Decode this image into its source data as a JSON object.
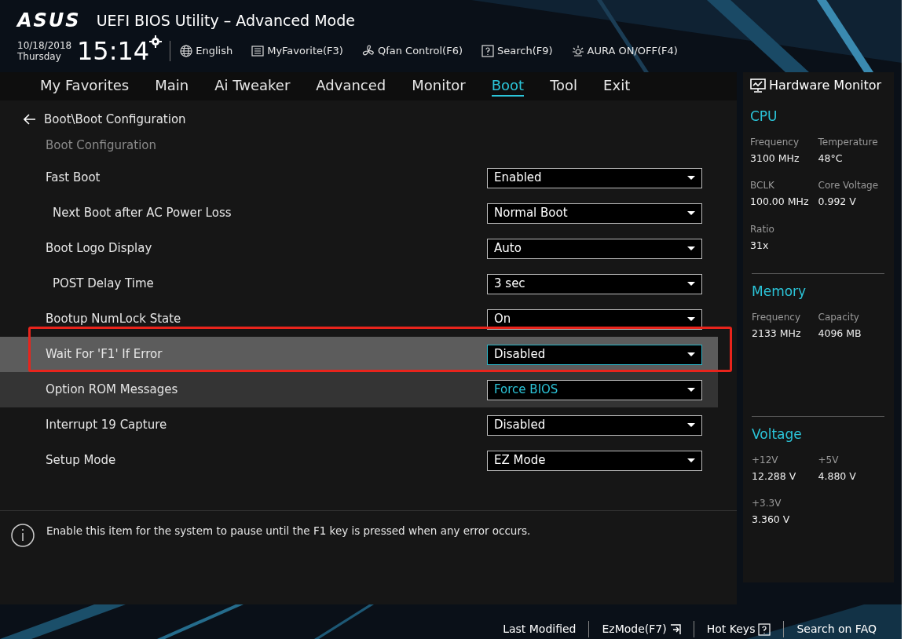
{
  "header": {
    "brand": "ASUS",
    "title": "UEFI BIOS Utility – Advanced Mode",
    "date": "10/18/2018",
    "day": "Thursday",
    "time": "15:14",
    "tools": [
      {
        "label": "English",
        "kind": "globe"
      },
      {
        "label": "MyFavorite(F3)",
        "kind": "favorite"
      },
      {
        "label": "Qfan Control(F6)",
        "kind": "fan"
      },
      {
        "label": "Search(F9)",
        "kind": "search"
      },
      {
        "label": "AURA ON/OFF(F4)",
        "kind": "aura"
      }
    ]
  },
  "tabs": [
    {
      "label": "My Favorites",
      "selected": false
    },
    {
      "label": "Main",
      "selected": false
    },
    {
      "label": "Ai Tweaker",
      "selected": false
    },
    {
      "label": "Advanced",
      "selected": false
    },
    {
      "label": "Monitor",
      "selected": false
    },
    {
      "label": "Boot",
      "selected": true
    },
    {
      "label": "Tool",
      "selected": false
    },
    {
      "label": "Exit",
      "selected": false
    }
  ],
  "breadcrumb": "Boot\\Boot Configuration",
  "section_title": "Boot Configuration",
  "settings": [
    {
      "label": "Fast Boot",
      "value": "Enabled",
      "selected": false,
      "hovered": false,
      "annotated": false,
      "children": [
        {
          "label": "Next Boot after AC Power Loss",
          "value": "Normal Boot",
          "selected": false,
          "hovered": false,
          "annotated": false
        }
      ]
    },
    {
      "label": "Boot Logo Display",
      "value": "Auto",
      "selected": false,
      "hovered": false,
      "annotated": false,
      "children": [
        {
          "label": "POST Delay Time",
          "value": "3 sec",
          "selected": false,
          "hovered": false,
          "annotated": false
        }
      ]
    },
    {
      "label": "Bootup NumLock State",
      "value": "On",
      "selected": false,
      "hovered": false,
      "annotated": false
    },
    {
      "label": "Wait For 'F1' If Error",
      "value": "Disabled",
      "selected": true,
      "hovered": false,
      "annotated": true
    },
    {
      "label": "Option ROM Messages",
      "value": "Force BIOS",
      "selected": false,
      "hovered": true,
      "annotated": false
    },
    {
      "label": "Interrupt 19 Capture",
      "value": "Disabled",
      "selected": false,
      "hovered": false,
      "annotated": false
    },
    {
      "label": "Setup Mode",
      "value": "EZ Mode",
      "selected": false,
      "hovered": false,
      "annotated": false
    }
  ],
  "help": "Enable this item for the system to pause until the F1 key is pressed when any error occurs.",
  "monitor": {
    "title": "Hardware Monitor",
    "sections": [
      {
        "title": "CPU",
        "items": [
          {
            "label": "Frequency",
            "value": "3100 MHz"
          },
          {
            "label": "Temperature",
            "value": "48°C"
          },
          {
            "label": "BCLK",
            "value": "100.00 MHz"
          },
          {
            "label": "Core Voltage",
            "value": "0.992 V"
          },
          {
            "label": "Ratio",
            "value": "31x"
          }
        ]
      },
      {
        "title": "Memory",
        "items": [
          {
            "label": "Frequency",
            "value": "2133 MHz"
          },
          {
            "label": "Capacity",
            "value": "4096 MB"
          }
        ]
      },
      {
        "title": "Voltage",
        "items": [
          {
            "label": "+12V",
            "value": "12.288 V"
          },
          {
            "label": "+5V",
            "value": "4.880 V"
          },
          {
            "label": "+3.3V",
            "value": "3.360 V"
          }
        ]
      }
    ]
  },
  "footer": [
    {
      "label": "Last Modified",
      "kind": "text"
    },
    {
      "label": "EzMode(F7)",
      "kind": "ezmode"
    },
    {
      "label": "Hot Keys",
      "kind": "hotkeys"
    },
    {
      "label": "Search on FAQ",
      "kind": "text"
    }
  ]
}
